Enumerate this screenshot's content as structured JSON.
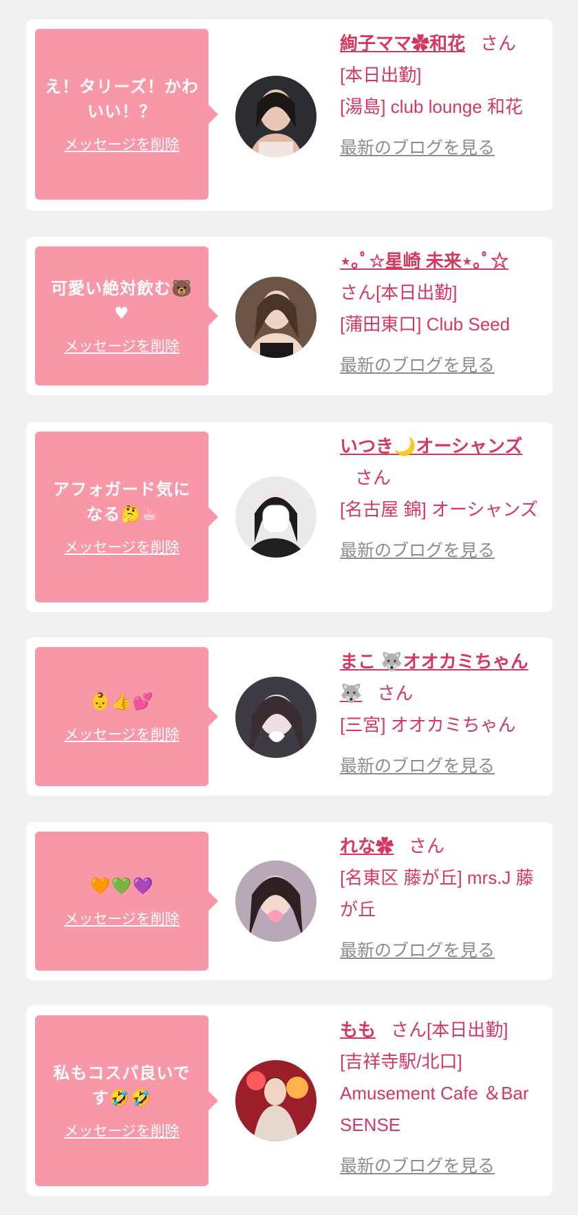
{
  "cards": [
    {
      "message": "え！タリーズ！かわいい！？",
      "delete_label": "メッセージを削除",
      "name": "絢子ママ✿和花",
      "san": "さん",
      "status": "[本日出勤]",
      "shop": "[湯島] club lounge 和花",
      "blog_label": "最新のブログを見る"
    },
    {
      "message": "可愛い絶対飲む🐻♥",
      "delete_label": "メッセージを削除",
      "name": "⋆｡ﾟ☆星崎 未来⋆｡ﾟ☆",
      "san": "さん",
      "status": "[本日出勤]",
      "shop": "[蒲田東口] Club Seed",
      "blog_label": "最新のブログを見る"
    },
    {
      "message": "アフォガード気になる🤔☕",
      "delete_label": "メッセージを削除",
      "name": "いつき🌙オーシャンズ",
      "san": "さん",
      "status": "",
      "shop": "[名古屋 錦] オーシャンズ",
      "blog_label": "最新のブログを見る"
    },
    {
      "message": "👶👍💕",
      "delete_label": "メッセージを削除",
      "name": "まこ 🐺オオカミちゃん🐺",
      "san": "さん",
      "status": "",
      "shop": "[三宮] オオカミちゃん",
      "blog_label": "最新のブログを見る"
    },
    {
      "message": "🧡💚💜",
      "delete_label": "メッセージを削除",
      "name": "れな✿",
      "san": "さん",
      "status": "",
      "shop": "[名東区 藤が丘] mrs.J 藤が丘",
      "blog_label": "最新のブログを見る"
    },
    {
      "message": "私もコスパ良いです🤣🤣",
      "delete_label": "メッセージを削除",
      "name": "もも",
      "san": "さん",
      "status": "[本日出勤]",
      "shop": "[吉祥寺駅/北口] Amusement Cafe ＆Bar SENSE",
      "blog_label": "最新のブログを見る"
    }
  ],
  "colors": {
    "accent": "#d6375f",
    "bubble": "#f797a8",
    "background": "#f1f1f1",
    "link_gray": "#8c8c8c"
  }
}
